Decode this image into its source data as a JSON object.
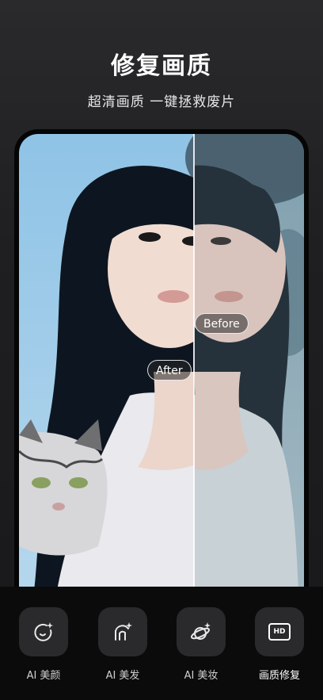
{
  "header": {
    "title": "修复画质",
    "subtitle": "超清画质 一键拯救废片"
  },
  "comparison": {
    "before_label": "Before",
    "after_label": "After"
  },
  "toolbar": {
    "items": [
      {
        "label": "AI 美颜",
        "icon": "face-sparkle-icon"
      },
      {
        "label": "AI 美发",
        "icon": "hair-sparkle-icon"
      },
      {
        "label": "AI 美妆",
        "icon": "makeup-planet-icon"
      },
      {
        "label": "画质修复",
        "icon": "hd-icon",
        "active": true,
        "badge": "HD"
      }
    ]
  }
}
